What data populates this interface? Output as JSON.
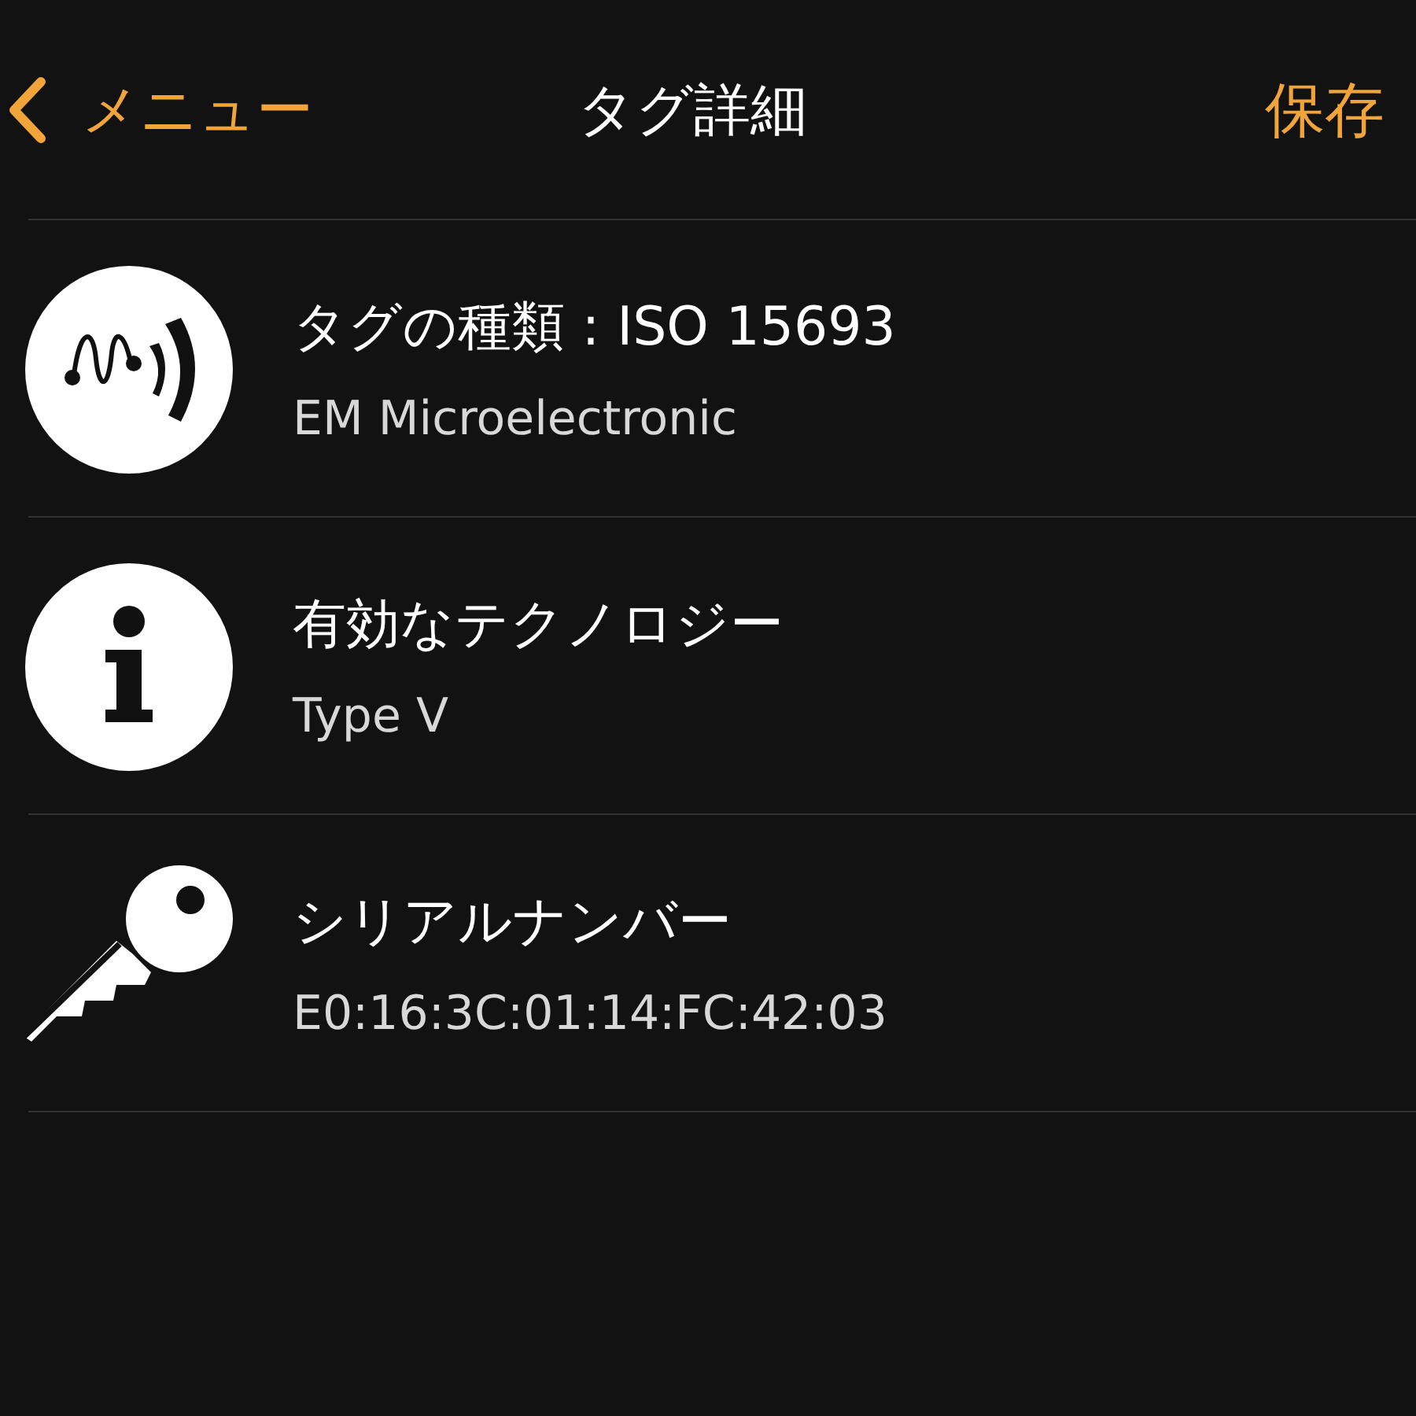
{
  "nav": {
    "back": "メニュー",
    "title": "タグ詳細",
    "action": "保存"
  },
  "rows": [
    {
      "kind": "nfc",
      "title": "タグの種類 : ISO 15693",
      "subtitle": "EM Microelectronic"
    },
    {
      "kind": "info",
      "title": "有効なテクノロジー",
      "subtitle": "Type V"
    },
    {
      "kind": "key",
      "title": "シリアルナンバー",
      "subtitle": "E0:16:3C:01:14:FC:42:03"
    }
  ]
}
